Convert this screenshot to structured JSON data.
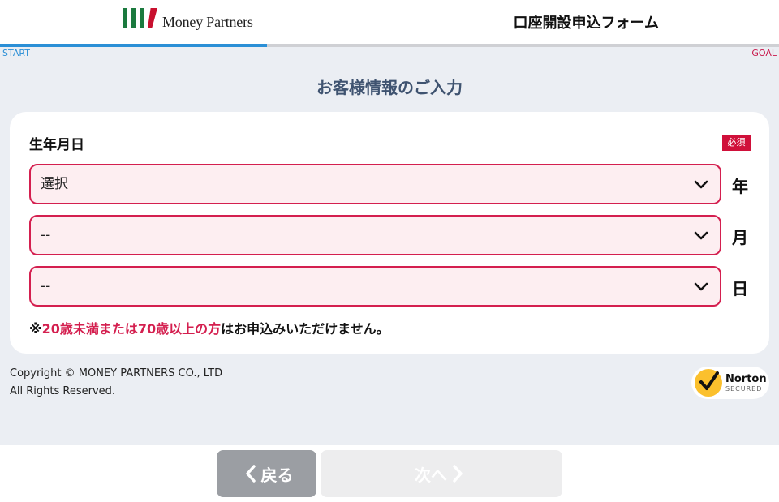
{
  "header": {
    "logo_text": "Money Partners",
    "form_title": "口座開設申込フォーム"
  },
  "progress": {
    "start_label": "START",
    "goal_label": "GOAL",
    "fraction": 0.343
  },
  "section_title": "お客様情報のご入力",
  "field": {
    "label": "生年月日",
    "required_badge": "必須",
    "year": {
      "value": "選択",
      "unit": "年"
    },
    "month": {
      "value": "--",
      "unit": "月"
    },
    "day": {
      "value": "--",
      "unit": "日"
    }
  },
  "notice": {
    "prefix": "※",
    "highlight": "20歳未満または70歳以上の方",
    "suffix": "はお申込みいただけません。"
  },
  "copyright": {
    "line1": "Copyright © MONEY PARTNERS CO., LTD",
    "line2": "All Rights Reserved."
  },
  "norton": {
    "name": "Norton",
    "sub": "SECURED"
  },
  "footer": {
    "back_label": "戻る",
    "next_label": "次へ"
  },
  "colors": {
    "accent_blue": "#2b8fd6",
    "accent_red": "#d41f4f",
    "brand_green": "#1b7a3e",
    "heading": "#3f5370"
  },
  "icons": [
    "chevron-down-icon",
    "chevron-left-icon",
    "chevron-right-icon",
    "norton-check-icon"
  ]
}
